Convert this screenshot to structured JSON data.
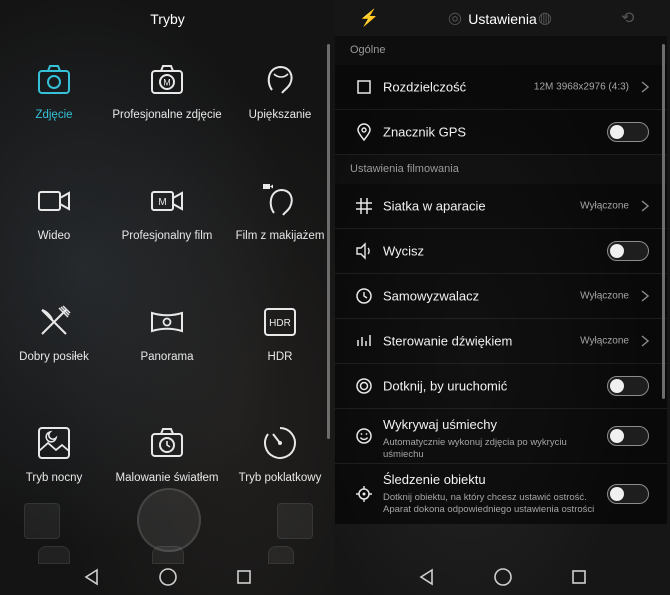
{
  "left": {
    "title": "Tryby",
    "modes": [
      {
        "label": "Zdjęcie",
        "icon": "camera-icon",
        "active": true
      },
      {
        "label": "Profesjonalne zdjęcie",
        "icon": "pro-camera-icon",
        "active": false
      },
      {
        "label": "Upiększanie",
        "icon": "beauty-face-icon",
        "active": false
      },
      {
        "label": "Wideo",
        "icon": "video-icon",
        "active": false
      },
      {
        "label": "Profesjonalny film",
        "icon": "pro-video-icon",
        "active": false
      },
      {
        "label": "Film z makijażem",
        "icon": "beauty-video-icon",
        "active": false
      },
      {
        "label": "Dobry posiłek",
        "icon": "fork-knife-icon",
        "active": false
      },
      {
        "label": "Panorama",
        "icon": "panorama-icon",
        "active": false
      },
      {
        "label": "HDR",
        "icon": "hdr-icon",
        "active": false
      },
      {
        "label": "Tryb nocny",
        "icon": "night-mode-icon",
        "active": false
      },
      {
        "label": "Malowanie światłem",
        "icon": "light-painting-icon",
        "active": false
      },
      {
        "label": "Tryb poklatkowy",
        "icon": "timelapse-icon",
        "active": false
      }
    ],
    "hdr_badge": "HDR",
    "pro_badge": "M"
  },
  "right": {
    "title": "Ustawienia",
    "sections": {
      "general": "Ogólne",
      "video": "Ustawienia filmowania"
    },
    "rows": {
      "resolution": {
        "label": "Rozdzielczość",
        "value": "12M 3968x2976 (4:3)"
      },
      "gps": {
        "label": "Znacznik GPS",
        "on": false
      },
      "grid": {
        "label": "Siatka w aparacie",
        "value": "Wyłączone"
      },
      "mute": {
        "label": "Wycisz",
        "on": false
      },
      "timer": {
        "label": "Samowyzwalacz",
        "value": "Wyłączone"
      },
      "audio": {
        "label": "Sterowanie dźwiękiem",
        "value": "Wyłączone"
      },
      "touch": {
        "label": "Dotknij, by uruchomić",
        "on": false
      },
      "smile": {
        "label": "Wykrywaj uśmiechy",
        "desc": "Automatycznie wykonuj zdjęcia po wykryciu uśmiechu",
        "on": false
      },
      "tracking": {
        "label": "Śledzenie obiektu",
        "desc": "Dotknij obiektu, na który chcesz ustawić ostrość. Aparat dokona odpowiedniego ustawienia ostrości",
        "on": false
      }
    }
  },
  "colors": {
    "accent": "#35c1d8",
    "text": "#f2f2f2",
    "muted": "#a5a5a5"
  }
}
